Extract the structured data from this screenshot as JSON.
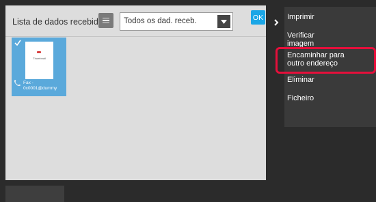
{
  "main": {
    "list_title": "Lista de dados recebidos",
    "filter_value": "Todos os dad. receb.",
    "ok_label": "OK",
    "thumbnail": {
      "page_label": "Thumbnail",
      "caption_line1": "Fax -",
      "caption_line2": "0x0001@dummy",
      "selected": true
    }
  },
  "menu": {
    "items": [
      {
        "line1": "Imprimir"
      },
      {
        "line1": "Verificar",
        "line2": "imagem"
      },
      {
        "line1": "Encaminhar para",
        "line2": "outro endereço"
      },
      {
        "line1": "Eliminar"
      },
      {
        "line1": "Ficheiro"
      }
    ]
  },
  "icons": {
    "list_view": "list-icon",
    "dropdown": "chevron-down-icon",
    "collapse": "chevron-right-icon",
    "check": "check-icon",
    "fax": "fax-icon"
  },
  "colors": {
    "ok_button": "#1aa6e6",
    "thumbnail_selected": "#5aa9db",
    "highlight": "#e60f3b",
    "menu_background": "#3a3a3a"
  }
}
